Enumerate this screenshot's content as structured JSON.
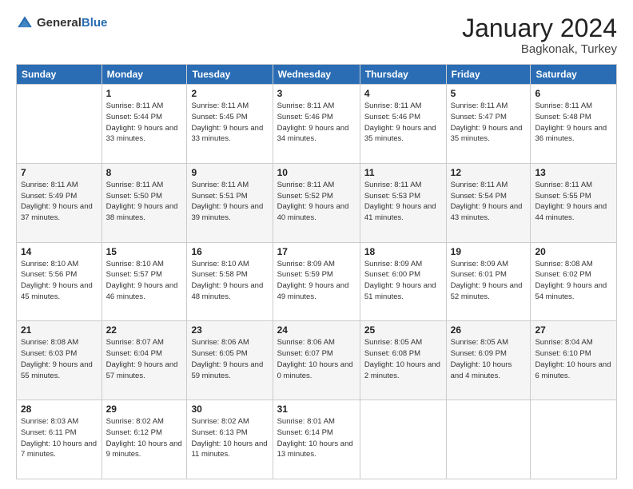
{
  "header": {
    "logo_general": "General",
    "logo_blue": "Blue",
    "month_title": "January 2024",
    "location": "Bagkonak, Turkey"
  },
  "weekdays": [
    "Sunday",
    "Monday",
    "Tuesday",
    "Wednesday",
    "Thursday",
    "Friday",
    "Saturday"
  ],
  "weeks": [
    [
      {
        "day": "",
        "info": ""
      },
      {
        "day": "1",
        "info": "Sunrise: 8:11 AM\nSunset: 5:44 PM\nDaylight: 9 hours\nand 33 minutes."
      },
      {
        "day": "2",
        "info": "Sunrise: 8:11 AM\nSunset: 5:45 PM\nDaylight: 9 hours\nand 33 minutes."
      },
      {
        "day": "3",
        "info": "Sunrise: 8:11 AM\nSunset: 5:46 PM\nDaylight: 9 hours\nand 34 minutes."
      },
      {
        "day": "4",
        "info": "Sunrise: 8:11 AM\nSunset: 5:46 PM\nDaylight: 9 hours\nand 35 minutes."
      },
      {
        "day": "5",
        "info": "Sunrise: 8:11 AM\nSunset: 5:47 PM\nDaylight: 9 hours\nand 35 minutes."
      },
      {
        "day": "6",
        "info": "Sunrise: 8:11 AM\nSunset: 5:48 PM\nDaylight: 9 hours\nand 36 minutes."
      }
    ],
    [
      {
        "day": "7",
        "info": "Sunrise: 8:11 AM\nSunset: 5:49 PM\nDaylight: 9 hours\nand 37 minutes."
      },
      {
        "day": "8",
        "info": "Sunrise: 8:11 AM\nSunset: 5:50 PM\nDaylight: 9 hours\nand 38 minutes."
      },
      {
        "day": "9",
        "info": "Sunrise: 8:11 AM\nSunset: 5:51 PM\nDaylight: 9 hours\nand 39 minutes."
      },
      {
        "day": "10",
        "info": "Sunrise: 8:11 AM\nSunset: 5:52 PM\nDaylight: 9 hours\nand 40 minutes."
      },
      {
        "day": "11",
        "info": "Sunrise: 8:11 AM\nSunset: 5:53 PM\nDaylight: 9 hours\nand 41 minutes."
      },
      {
        "day": "12",
        "info": "Sunrise: 8:11 AM\nSunset: 5:54 PM\nDaylight: 9 hours\nand 43 minutes."
      },
      {
        "day": "13",
        "info": "Sunrise: 8:11 AM\nSunset: 5:55 PM\nDaylight: 9 hours\nand 44 minutes."
      }
    ],
    [
      {
        "day": "14",
        "info": "Sunrise: 8:10 AM\nSunset: 5:56 PM\nDaylight: 9 hours\nand 45 minutes."
      },
      {
        "day": "15",
        "info": "Sunrise: 8:10 AM\nSunset: 5:57 PM\nDaylight: 9 hours\nand 46 minutes."
      },
      {
        "day": "16",
        "info": "Sunrise: 8:10 AM\nSunset: 5:58 PM\nDaylight: 9 hours\nand 48 minutes."
      },
      {
        "day": "17",
        "info": "Sunrise: 8:09 AM\nSunset: 5:59 PM\nDaylight: 9 hours\nand 49 minutes."
      },
      {
        "day": "18",
        "info": "Sunrise: 8:09 AM\nSunset: 6:00 PM\nDaylight: 9 hours\nand 51 minutes."
      },
      {
        "day": "19",
        "info": "Sunrise: 8:09 AM\nSunset: 6:01 PM\nDaylight: 9 hours\nand 52 minutes."
      },
      {
        "day": "20",
        "info": "Sunrise: 8:08 AM\nSunset: 6:02 PM\nDaylight: 9 hours\nand 54 minutes."
      }
    ],
    [
      {
        "day": "21",
        "info": "Sunrise: 8:08 AM\nSunset: 6:03 PM\nDaylight: 9 hours\nand 55 minutes."
      },
      {
        "day": "22",
        "info": "Sunrise: 8:07 AM\nSunset: 6:04 PM\nDaylight: 9 hours\nand 57 minutes."
      },
      {
        "day": "23",
        "info": "Sunrise: 8:06 AM\nSunset: 6:05 PM\nDaylight: 9 hours\nand 59 minutes."
      },
      {
        "day": "24",
        "info": "Sunrise: 8:06 AM\nSunset: 6:07 PM\nDaylight: 10 hours\nand 0 minutes."
      },
      {
        "day": "25",
        "info": "Sunrise: 8:05 AM\nSunset: 6:08 PM\nDaylight: 10 hours\nand 2 minutes."
      },
      {
        "day": "26",
        "info": "Sunrise: 8:05 AM\nSunset: 6:09 PM\nDaylight: 10 hours\nand 4 minutes."
      },
      {
        "day": "27",
        "info": "Sunrise: 8:04 AM\nSunset: 6:10 PM\nDaylight: 10 hours\nand 6 minutes."
      }
    ],
    [
      {
        "day": "28",
        "info": "Sunrise: 8:03 AM\nSunset: 6:11 PM\nDaylight: 10 hours\nand 7 minutes."
      },
      {
        "day": "29",
        "info": "Sunrise: 8:02 AM\nSunset: 6:12 PM\nDaylight: 10 hours\nand 9 minutes."
      },
      {
        "day": "30",
        "info": "Sunrise: 8:02 AM\nSunset: 6:13 PM\nDaylight: 10 hours\nand 11 minutes."
      },
      {
        "day": "31",
        "info": "Sunrise: 8:01 AM\nSunset: 6:14 PM\nDaylight: 10 hours\nand 13 minutes."
      },
      {
        "day": "",
        "info": ""
      },
      {
        "day": "",
        "info": ""
      },
      {
        "day": "",
        "info": ""
      }
    ]
  ]
}
